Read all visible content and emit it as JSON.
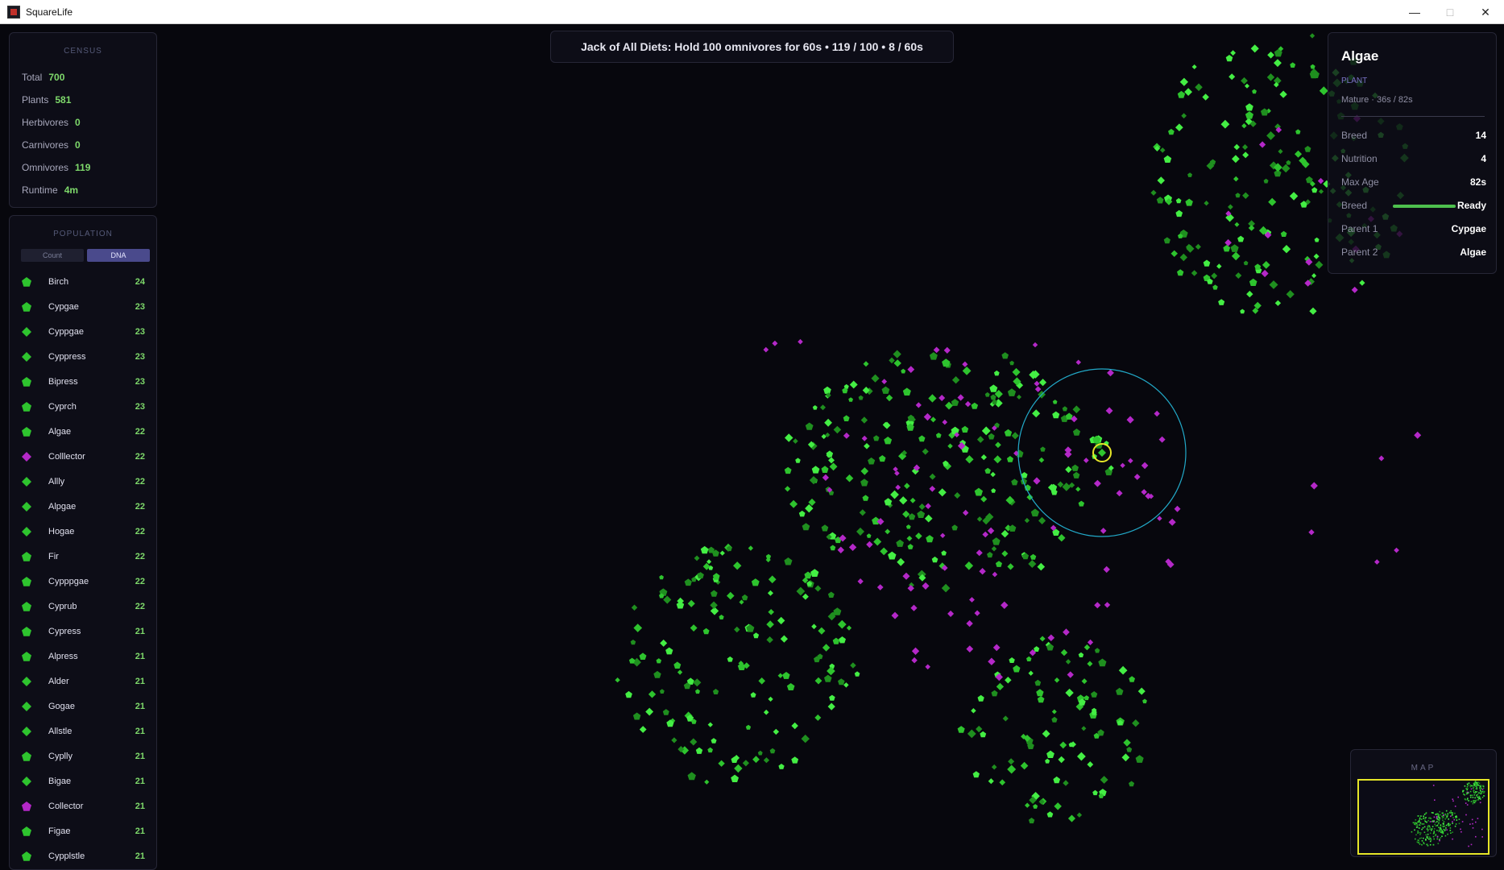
{
  "window": {
    "title": "SquareLife"
  },
  "objective": {
    "text": "Jack of All Diets: Hold 100 omnivores for 60s  •  119 / 100  •  8 / 60s"
  },
  "census": {
    "heading": "CENSUS",
    "rows": [
      {
        "label": "Total",
        "value": "700"
      },
      {
        "label": "Plants",
        "value": "581"
      },
      {
        "label": "Herbivores",
        "value": "0"
      },
      {
        "label": "Carnivores",
        "value": "0"
      },
      {
        "label": "Omnivores",
        "value": "119"
      },
      {
        "label": "Runtime",
        "value": "4m"
      }
    ]
  },
  "population": {
    "heading": "POPULATION",
    "tabs": [
      {
        "label": "Count",
        "active": false
      },
      {
        "label": "DNA",
        "active": true
      }
    ],
    "items": [
      {
        "name": "Birch",
        "count": "24",
        "shape": "pentagon",
        "color": "#2ec42e"
      },
      {
        "name": "Cypgae",
        "count": "23",
        "shape": "pentagon",
        "color": "#2ec42e"
      },
      {
        "name": "Cyppgae",
        "count": "23",
        "shape": "diamond",
        "color": "#2ec42e"
      },
      {
        "name": "Cyppress",
        "count": "23",
        "shape": "diamond",
        "color": "#2ec42e"
      },
      {
        "name": "Bipress",
        "count": "23",
        "shape": "pentagon",
        "color": "#2ec42e"
      },
      {
        "name": "Cyprch",
        "count": "23",
        "shape": "pentagon",
        "color": "#2ec42e"
      },
      {
        "name": "Algae",
        "count": "22",
        "shape": "pentagon",
        "color": "#2ec42e"
      },
      {
        "name": "Colllector",
        "count": "22",
        "shape": "diamond",
        "color": "#b428c8"
      },
      {
        "name": "Allly",
        "count": "22",
        "shape": "diamond",
        "color": "#2ec42e"
      },
      {
        "name": "Alpgae",
        "count": "22",
        "shape": "diamond",
        "color": "#2ec42e"
      },
      {
        "name": "Hogae",
        "count": "22",
        "shape": "diamond",
        "color": "#2ec42e"
      },
      {
        "name": "Fir",
        "count": "22",
        "shape": "pentagon",
        "color": "#2ec42e"
      },
      {
        "name": "Cypppgae",
        "count": "22",
        "shape": "pentagon",
        "color": "#2ec42e"
      },
      {
        "name": "Cyprub",
        "count": "22",
        "shape": "pentagon",
        "color": "#2ec42e"
      },
      {
        "name": "Cypress",
        "count": "21",
        "shape": "pentagon",
        "color": "#2ec42e"
      },
      {
        "name": "Alpress",
        "count": "21",
        "shape": "pentagon",
        "color": "#2ec42e"
      },
      {
        "name": "Alder",
        "count": "21",
        "shape": "diamond",
        "color": "#2ec42e"
      },
      {
        "name": "Gogae",
        "count": "21",
        "shape": "diamond",
        "color": "#2ec42e"
      },
      {
        "name": "Allstle",
        "count": "21",
        "shape": "diamond",
        "color": "#2ec42e"
      },
      {
        "name": "Cyplly",
        "count": "21",
        "shape": "pentagon",
        "color": "#2ec42e"
      },
      {
        "name": "Bigae",
        "count": "21",
        "shape": "diamond",
        "color": "#2ec42e"
      },
      {
        "name": "Collector",
        "count": "21",
        "shape": "pentagon",
        "color": "#b428c8"
      },
      {
        "name": "Figae",
        "count": "21",
        "shape": "pentagon",
        "color": "#2ec42e"
      },
      {
        "name": "Cypplstle",
        "count": "21",
        "shape": "pentagon",
        "color": "#2ec42e"
      }
    ]
  },
  "inspector": {
    "name": "Algae",
    "type": "PLANT",
    "stage": "Mature  ·  36s / 82s",
    "rows": [
      {
        "label": "Breed",
        "value": "14"
      },
      {
        "label": "Nutrition",
        "value": "4"
      },
      {
        "label": "Max Age",
        "value": "82s"
      },
      {
        "label": "Breed",
        "value": "Ready",
        "bar_fraction": 1.0
      },
      {
        "label": "Parent 1",
        "value": "Cypgae"
      },
      {
        "label": "Parent 2",
        "value": "Algae"
      }
    ]
  },
  "minimap": {
    "title": "MAP"
  },
  "colors": {
    "plant": "#2ec42e",
    "plant_bright": "#44ee44",
    "plant_dim": "#1f8f1f",
    "omnivore": "#b428c8",
    "selection_ring": "#e6e628",
    "sense_radius": "#22a9c8",
    "viewport": "#e6e628"
  }
}
